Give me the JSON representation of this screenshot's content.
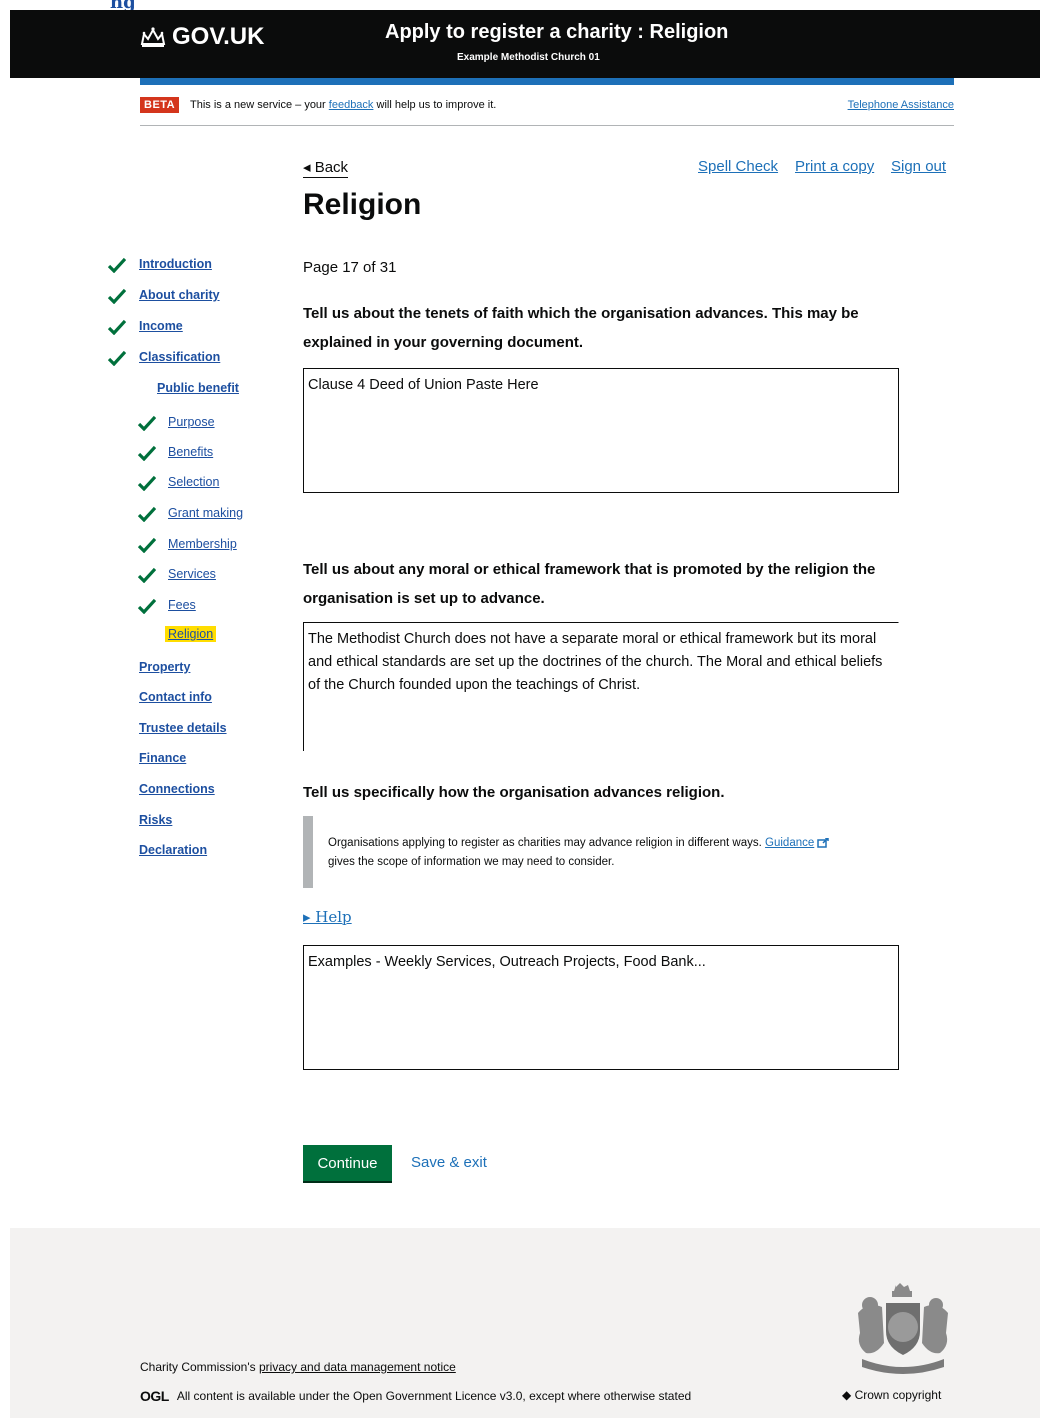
{
  "header": {
    "logo_text": "GOV.UK",
    "service_title": "Apply to register a charity : Religion",
    "service_subtitle": "Example Methodist Church 01"
  },
  "top_cut_link": "ng",
  "beta_banner": {
    "tag": "BETA",
    "text_before": "This is a new service – your",
    "feedback_link": "feedback",
    "text_after": "will help us to improve it.",
    "telephone_link": "Telephone Assistance"
  },
  "nav_links": {
    "back": "◂ Back",
    "spell_check": "Spell Check",
    "print": "Print a copy",
    "sign_out": "Sign out"
  },
  "page": {
    "title": "Religion",
    "page_count": "Page 17 of 31"
  },
  "sidebar": {
    "main_items": [
      {
        "label": "Introduction",
        "complete": true
      },
      {
        "label": "About charity",
        "complete": true
      },
      {
        "label": "Income",
        "complete": true
      },
      {
        "label": "Classification",
        "complete": true
      }
    ],
    "section_heading": "Public benefit",
    "sub_items": [
      {
        "label": "Purpose",
        "complete": true
      },
      {
        "label": "Benefits",
        "complete": true
      },
      {
        "label": "Selection",
        "complete": true
      },
      {
        "label": "Grant making",
        "complete": true
      },
      {
        "label": "Membership",
        "complete": true
      },
      {
        "label": "Services",
        "complete": true
      },
      {
        "label": "Fees",
        "complete": true
      }
    ],
    "current_item": "Religion",
    "remaining_items": [
      {
        "label": "Property"
      },
      {
        "label": "Contact info"
      },
      {
        "label": "Trustee details"
      },
      {
        "label": "Finance"
      },
      {
        "label": "Connections"
      },
      {
        "label": "Risks"
      },
      {
        "label": "Declaration"
      }
    ]
  },
  "questions": [
    {
      "question": "Tell us about the tenets of faith which the organisation advances. This may be explained in your governing document.",
      "answer": "Clause 4 Deed of Union Paste Here"
    },
    {
      "question": "Tell us about any moral or ethical framework that is promoted by the religion the organisation is set up to advance.",
      "answer": "The Methodist Church does not have a separate moral or ethical framework but its moral and ethical standards are set up the doctrines of the church. The Moral and ethical beliefs of the Church founded upon the teachings of Christ."
    },
    {
      "question": "Tell us specifically how the organisation advances religion.",
      "answer": "Examples - Weekly Services, Outreach Projects, Food Bank..."
    }
  ],
  "inset": {
    "text_before": "Organisations applying to register as charities may advance religion in different ways.",
    "guidance_link": "Guidance",
    "text_after": "gives the scope of information we may need to consider."
  },
  "help_toggle": "▸ Help",
  "actions": {
    "continue": "Continue",
    "save_exit": "Save & exit"
  },
  "footer": {
    "privacy_prefix": "Charity Commission's",
    "privacy_link": "privacy and data management notice",
    "ogl_logo": "OGL",
    "licence_prefix": "All content is available under the",
    "licence_link": "Open Government Licence v3.0",
    "licence_suffix": ", except where otherwise stated",
    "crown_copyright": "Crown copyright"
  },
  "colors": {
    "header_bg": "#0b0c0c",
    "blue_bar": "#1d70b8",
    "beta_tag": "#d4351c",
    "continue_button": "#00703c",
    "tick": "#00703c",
    "current_highlight": "#ffdd00",
    "footer_bg": "#f3f2f1"
  }
}
